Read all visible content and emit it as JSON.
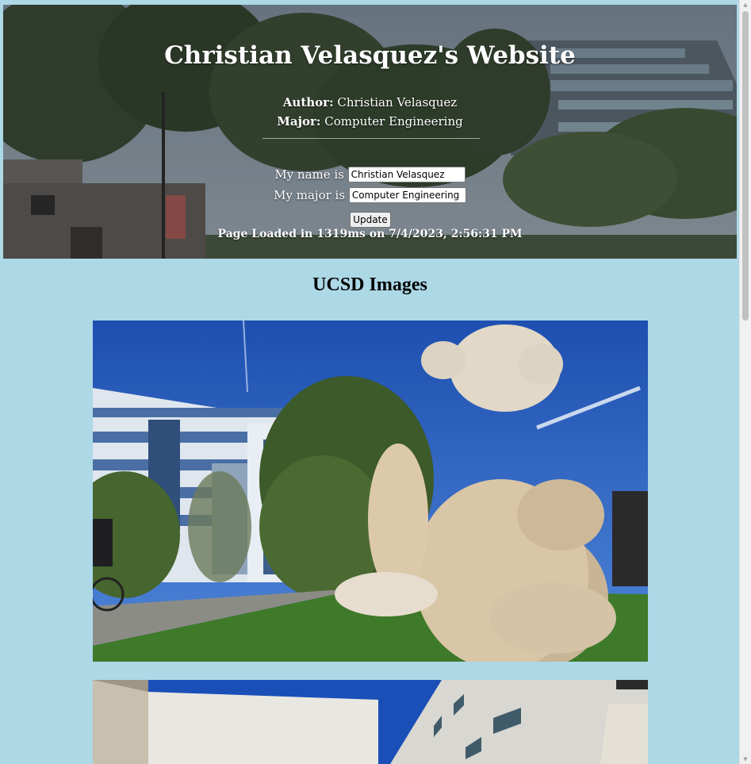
{
  "header": {
    "title": "Christian Velasquez's Website",
    "author_label": "Author:",
    "author_value": "Christian Velasquez",
    "major_label": "Major:",
    "major_value": "Computer Engineering"
  },
  "form": {
    "name_label": "My name is",
    "name_value": "Christian Velasquez",
    "major_label": "My major is",
    "major_value": "Computer Engineering",
    "update_label": "Update"
  },
  "status": {
    "loaded_text": "Page Loaded in 1319ms on 7/4/2023, 2:56:31 PM"
  },
  "images_section": {
    "title": "UCSD Images"
  },
  "colors": {
    "page_background": "#add8e6",
    "header_text": "#ffffff",
    "sky": "#2f6fd0",
    "grass": "#3f7a2a"
  },
  "scrollbar": {
    "up_icon": "scroll-up-icon",
    "down_icon": "scroll-down-icon"
  }
}
